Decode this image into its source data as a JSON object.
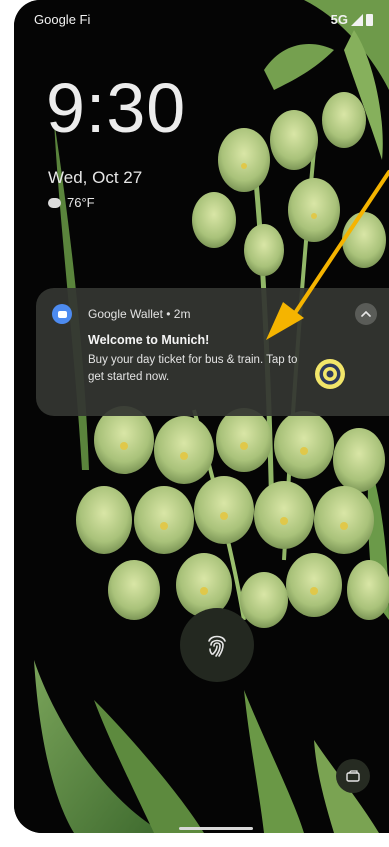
{
  "status_bar": {
    "carrier": "Google Fi",
    "network": "5G",
    "icons": [
      "signal-icon",
      "battery-icon"
    ]
  },
  "lock_screen": {
    "time": "9:30",
    "date": "Wed, Oct 27",
    "weather": {
      "icon": "cloud-icon",
      "temperature": "76°F"
    }
  },
  "notification": {
    "app_icon": "wallet-icon",
    "header": "Google Wallet • 2m",
    "title": "Welcome to Munich!",
    "body": "Buy your day ticket for bus & train. Tap to get started now.",
    "action_icon": "target-icon",
    "expand_icon": "chevron-up-icon"
  },
  "controls": {
    "fingerprint_icon": "fingerprint-icon",
    "shortcut_icon": "wallet-card-icon"
  },
  "colors": {
    "annotation_arrow": "#f5b400",
    "notification_bg": "#343632",
    "wallet_blue": "#4d8bf0",
    "target_yellow": "#f2e66a"
  }
}
